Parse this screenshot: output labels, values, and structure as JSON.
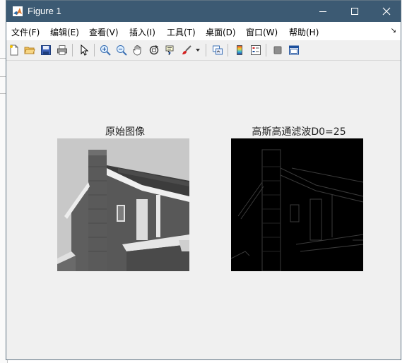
{
  "window": {
    "title": "Figure 1"
  },
  "menu": [
    {
      "label": "文件(F)"
    },
    {
      "label": "编辑(E)"
    },
    {
      "label": "查看(V)"
    },
    {
      "label": "插入(I)"
    },
    {
      "label": "工具(T)"
    },
    {
      "label": "桌面(D)"
    },
    {
      "label": "窗口(W)"
    },
    {
      "label": "帮助(H)"
    }
  ],
  "toolbar": {
    "icons": [
      "new-figure",
      "open-file",
      "save",
      "print",
      "edit-plot",
      "zoom-in",
      "zoom-out",
      "pan",
      "rotate-3d",
      "data-cursor",
      "brush",
      "link-plot",
      "insert-colorbar",
      "insert-legend",
      "hide-plot-tools",
      "show-plot-tools"
    ]
  },
  "axes": [
    {
      "title": "原始图像"
    },
    {
      "title": "高斯高通滤波D0=25"
    }
  ],
  "colors": {
    "titlebar": "#3c5a73",
    "figure_bg": "#f0f0f0"
  }
}
